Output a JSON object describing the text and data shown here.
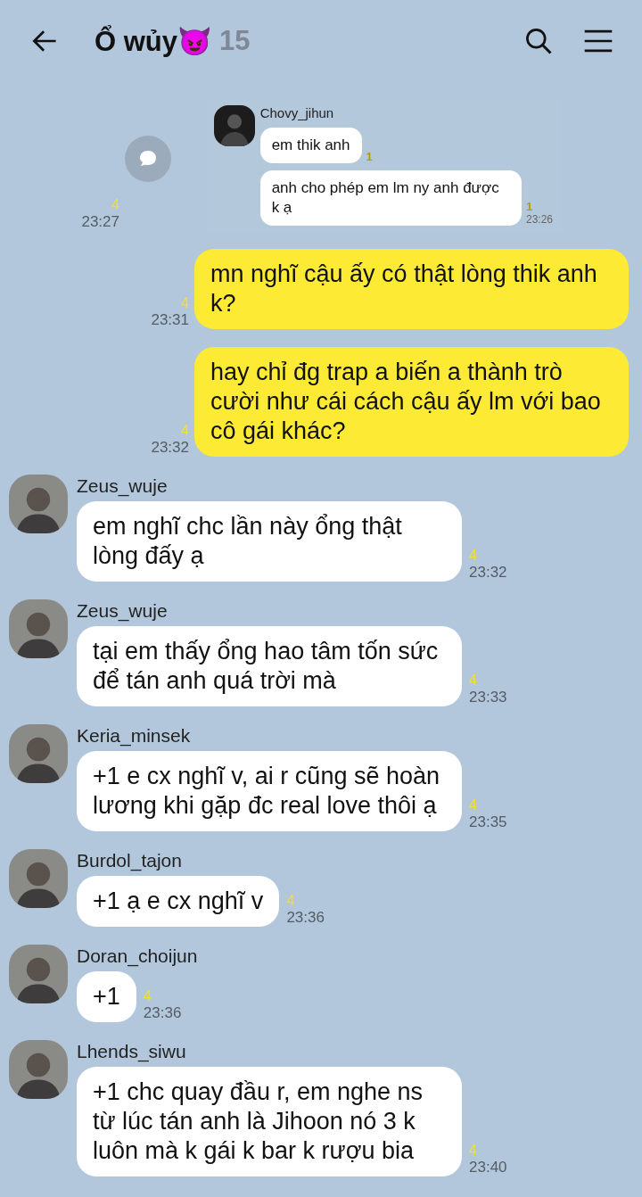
{
  "header": {
    "title": "Ổ wủy😈",
    "member_count": "15"
  },
  "messages": [
    {
      "kind": "shared_image",
      "unread": "4",
      "time": "23:27",
      "screenshot": {
        "sender": "Chovy_jihun",
        "messages": [
          {
            "text": "em thik anh",
            "unread": "1"
          },
          {
            "text": "anh cho phép em lm ny anh được k ạ",
            "unread": "1",
            "time": "23:26"
          }
        ]
      }
    },
    {
      "kind": "mine",
      "text": "mn nghĩ cậu ấy có thật lòng thik anh k?",
      "unread": "4",
      "time": "23:31"
    },
    {
      "kind": "mine",
      "text": "hay chỉ đg trap a biến a thành trò cười như cái cách cậu ấy lm với bao cô gái khác?",
      "unread": "4",
      "time": "23:32"
    },
    {
      "kind": "theirs",
      "sender": "Zeus_wuje",
      "text": "em nghĩ chc lần này ổng thật lòng đấy ạ",
      "unread": "4",
      "time": "23:32"
    },
    {
      "kind": "theirs",
      "sender": "Zeus_wuje",
      "text": "tại em thấy ổng hao tâm tốn sức để tán anh quá trời mà",
      "unread": "4",
      "time": "23:33"
    },
    {
      "kind": "theirs",
      "sender": "Keria_minsek",
      "text": "+1 e cx nghĩ v, ai r cũng sẽ hoàn lương khi gặp đc real love thôi ạ",
      "unread": "4",
      "time": "23:35"
    },
    {
      "kind": "theirs",
      "sender": "Burdol_tajon",
      "text": "+1 ạ e cx nghĩ v",
      "unread": "4",
      "time": "23:36"
    },
    {
      "kind": "theirs",
      "sender": "Doran_choijun",
      "text": "+1",
      "unread": "4",
      "time": "23:36"
    },
    {
      "kind": "theirs",
      "sender": "Lhends_siwu",
      "text": "+1 chc quay đầu r, em nghe ns từ lúc tán anh là Jihoon nó 3 k luôn mà k gái k bar k rượu bia",
      "unread": "4",
      "time": "23:40"
    }
  ]
}
